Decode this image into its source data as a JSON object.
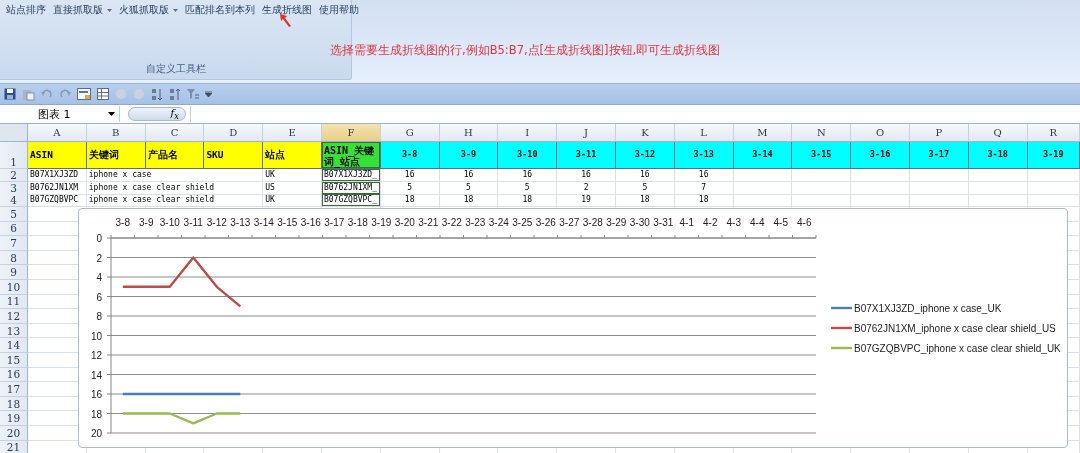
{
  "ribbon": {
    "buttons": [
      {
        "label": "站点排序",
        "dropdown": false
      },
      {
        "label": "直接抓取版",
        "dropdown": true
      },
      {
        "label": "火狐抓取版",
        "dropdown": true
      },
      {
        "label": "匹配排名到本列",
        "dropdown": false
      },
      {
        "label": "生成折线图",
        "dropdown": false
      },
      {
        "label": "使用帮助",
        "dropdown": false
      }
    ],
    "group_label": "自定义工具栏",
    "annotation": "选择需要生成折线图的行,例如B5:B7,点[生成折线图]按钮,即可生成折线图"
  },
  "name_box": {
    "value": "图表 1"
  },
  "formula_bar": {
    "label": "f$_{x}$"
  },
  "sheet": {
    "columns": [
      {
        "label": "A",
        "selected": false
      },
      {
        "label": "B",
        "selected": false
      },
      {
        "label": "C",
        "selected": false
      },
      {
        "label": "D",
        "selected": false
      },
      {
        "label": "E",
        "selected": false
      },
      {
        "label": "F",
        "selected": true
      },
      {
        "label": "G",
        "selected": false
      },
      {
        "label": "H",
        "selected": false
      },
      {
        "label": "I",
        "selected": false
      },
      {
        "label": "J",
        "selected": false
      },
      {
        "label": "K",
        "selected": false
      },
      {
        "label": "L",
        "selected": false
      },
      {
        "label": "M",
        "selected": false
      },
      {
        "label": "N",
        "selected": false
      },
      {
        "label": "O",
        "selected": false
      },
      {
        "label": "P",
        "selected": false
      },
      {
        "label": "Q",
        "selected": false
      },
      {
        "label": "R",
        "selected": false
      }
    ],
    "row_numbers": [
      "1",
      "2",
      "3",
      "4",
      "5",
      "6",
      "7",
      "8",
      "9",
      "10",
      "11",
      "12",
      "13",
      "14",
      "15",
      "16",
      "17",
      "18",
      "19",
      "20",
      "21"
    ],
    "header_row": [
      {
        "text": "ASIN",
        "kind": "field"
      },
      {
        "text": "关键词",
        "kind": "field"
      },
      {
        "text": "产品名",
        "kind": "field"
      },
      {
        "text": "SKU",
        "kind": "field"
      },
      {
        "text": "站点",
        "kind": "field"
      },
      {
        "text": "ASIN_关键词_站点",
        "kind": "key"
      },
      {
        "text": "3-8",
        "kind": "date"
      },
      {
        "text": "3-9",
        "kind": "date"
      },
      {
        "text": "3-10",
        "kind": "date"
      },
      {
        "text": "3-11",
        "kind": "date"
      },
      {
        "text": "3-12",
        "kind": "date"
      },
      {
        "text": "3-13",
        "kind": "date"
      },
      {
        "text": "3-14",
        "kind": "date"
      },
      {
        "text": "3-15",
        "kind": "date"
      },
      {
        "text": "3-16",
        "kind": "date"
      },
      {
        "text": "3-17",
        "kind": "date"
      },
      {
        "text": "3-18",
        "kind": "date"
      },
      {
        "text": "3-19",
        "kind": "date"
      }
    ],
    "rows": [
      {
        "asin": "B07X1XJ3ZD",
        "keyword": "iphone x case",
        "site": "UK",
        "key": "B07X1XJ3ZD_",
        "ranks": [
          "16",
          "16",
          "16",
          "16",
          "16",
          "16"
        ]
      },
      {
        "asin": "B0762JN1XM",
        "keyword": "iphone x case clear shield",
        "site": "US",
        "key": "B0762JN1XM_",
        "ranks": [
          "5",
          "5",
          "5",
          "2",
          "5",
          "7"
        ]
      },
      {
        "asin": "B07GZQBVPC",
        "keyword": "iphone x case clear shield",
        "site": "UK",
        "key": "B07GZQBVPC_",
        "ranks": [
          "18",
          "18",
          "18",
          "19",
          "18",
          "18"
        ]
      }
    ],
    "chart": {
      "chart_data": {
        "type": "line",
        "categories": [
          "3-8",
          "3-9",
          "3-10",
          "3-11",
          "3-12",
          "3-13",
          "3-14",
          "3-15",
          "3-16",
          "3-17",
          "3-18",
          "3-19",
          "3-20",
          "3-21",
          "3-22",
          "3-23",
          "3-24",
          "3-25",
          "3-26",
          "3-27",
          "3-28",
          "3-29",
          "3-30",
          "3-31",
          "4-1",
          "4-2",
          "4-3",
          "4-4",
          "4-5",
          "4-6"
        ],
        "ylim": [
          20,
          0
        ],
        "grid": true,
        "legend": true,
        "yticks": [
          0,
          2,
          4,
          6,
          8,
          10,
          12,
          14,
          16,
          18,
          20
        ],
        "series": [
          {
            "name": "B07X1XJ3ZD_iphone x case_UK",
            "color": "#4a7ebb",
            "values": [
              16,
              16,
              16,
              16,
              16,
              16,
              null,
              null,
              null,
              null,
              null,
              null,
              null,
              null,
              null,
              null,
              null,
              null,
              null,
              null,
              null,
              null,
              null,
              null,
              null,
              null,
              null,
              null,
              null,
              null
            ]
          },
          {
            "name": "B0762JN1XM_iphone x case clear shield_US",
            "color": "#be4b48",
            "values": [
              5,
              5,
              5,
              2,
              5,
              7,
              null,
              null,
              null,
              null,
              null,
              null,
              null,
              null,
              null,
              null,
              null,
              null,
              null,
              null,
              null,
              null,
              null,
              null,
              null,
              null,
              null,
              null,
              null,
              null
            ]
          },
          {
            "name": "B07GZQBVPC_iphone x case clear shield_UK",
            "color": "#98b954",
            "values": [
              18,
              18,
              18,
              19,
              18,
              18,
              null,
              null,
              null,
              null,
              null,
              null,
              null,
              null,
              null,
              null,
              null,
              null,
              null,
              null,
              null,
              null,
              null,
              null,
              null,
              null,
              null,
              null,
              null,
              null
            ]
          }
        ]
      }
    }
  }
}
